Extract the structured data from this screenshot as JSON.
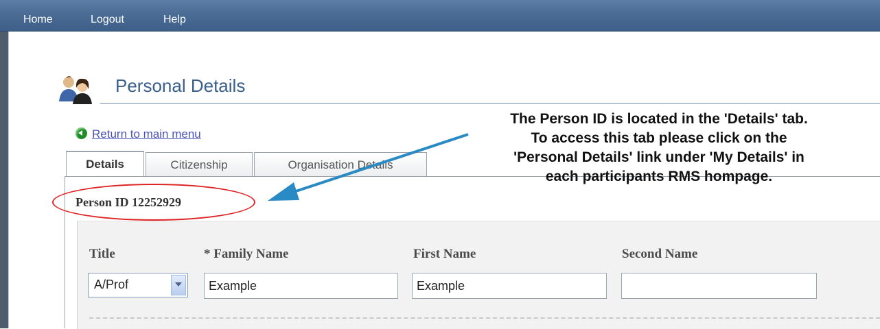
{
  "nav": {
    "home": "Home",
    "logout": "Logout",
    "help": "Help"
  },
  "page": {
    "title": "Personal Details",
    "icon": "users-icon"
  },
  "return_link": {
    "label": "Return to main menu",
    "icon": "back-arrow-icon"
  },
  "tabs": [
    {
      "label": "Details",
      "active": true
    },
    {
      "label": "Citizenship",
      "active": false
    },
    {
      "label": "Organisation Details",
      "active": false
    }
  ],
  "person_id": "Person ID 12252929",
  "form": {
    "title_label": "Title",
    "title_value": "A/Prof",
    "family_name_label": "* Family Name",
    "family_name_value": "Example",
    "first_name_label": "First Name",
    "first_name_value": "Example",
    "second_name_label": "Second Name",
    "second_name_value": ""
  },
  "annotation": {
    "lines": [
      "The Person ID is located in the 'Details' tab.",
      "To access this tab please click on the",
      "'Personal Details' link under 'My Details' in",
      "each participants RMS hompage."
    ],
    "arrow_color": "#2a8ac4",
    "circle_color": "#e02424"
  }
}
